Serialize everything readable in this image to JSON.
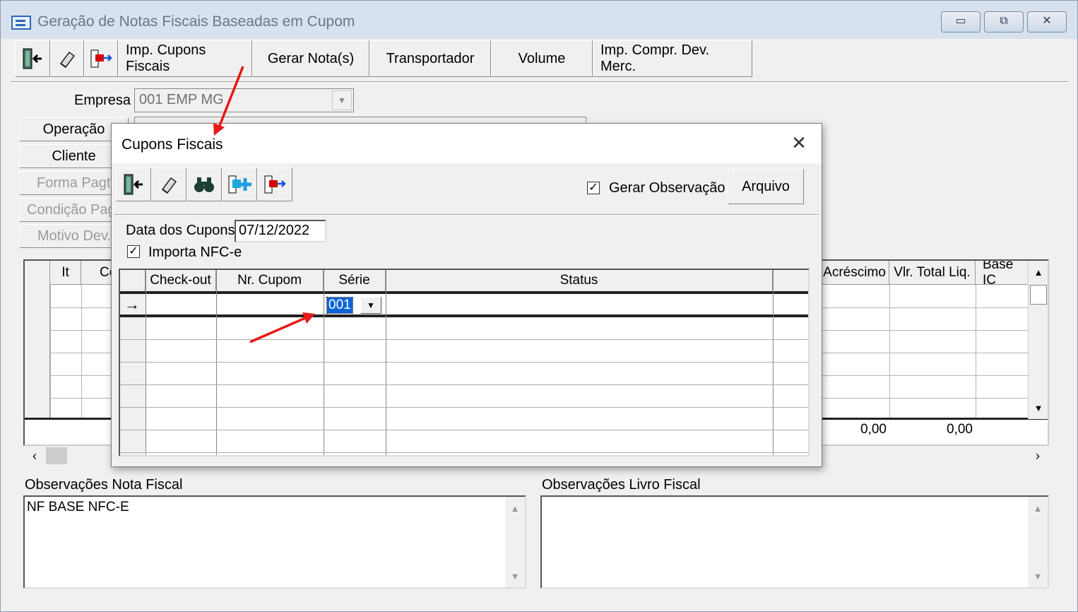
{
  "window": {
    "title": "Geração de Notas Fiscais Baseadas em Cupom",
    "controls": {
      "minimize": "▭",
      "restore": "⧉",
      "close": "✕"
    }
  },
  "toolbar": {
    "icons": [
      "exit-icon",
      "eraser-icon",
      "export-icon"
    ],
    "buttons": [
      "Imp. Cupons Fiscais",
      "Gerar Nota(s)",
      "Transportador",
      "Volume",
      "Imp. Compr. Dev. Merc."
    ]
  },
  "form": {
    "empresa_label": "Empresa",
    "empresa_value": "001 EMP MG",
    "operacao": "Operação",
    "cliente": "Cliente",
    "forma_pagto": "Forma Pagto",
    "condicao_pag": "Condição Pag",
    "motivo_dev": "Motivo Dev."
  },
  "bg_grid": {
    "columns": [
      "It",
      "Co",
      "Acréscimo",
      "Vlr. Total Liq.",
      "Base IC"
    ],
    "totals": [
      "0,00",
      "0,00"
    ]
  },
  "observacoes": {
    "nf_label": "Observações Nota Fiscal",
    "nf_value": "NF BASE NFC-E",
    "livro_label": "Observações Livro Fiscal",
    "livro_value": ""
  },
  "dialog": {
    "title": "Cupons Fiscais",
    "close": "✕",
    "icons": [
      "exit-icon",
      "eraser-icon",
      "binoculars-icon",
      "add-icon",
      "export-icon"
    ],
    "gerar_observacao": "Gerar Observação",
    "gerar_observacao_checked": true,
    "arquivo": "Arquivo",
    "data_label": "Data dos Cupons",
    "data_value": "07/12/2022",
    "importa_nfce": "Importa NFC-e",
    "importa_nfce_checked": true,
    "grid": {
      "columns": [
        "Check-out",
        "Nr. Cupom",
        "Série",
        "Status"
      ],
      "row_indicator": "→",
      "serie_value": "001"
    }
  }
}
